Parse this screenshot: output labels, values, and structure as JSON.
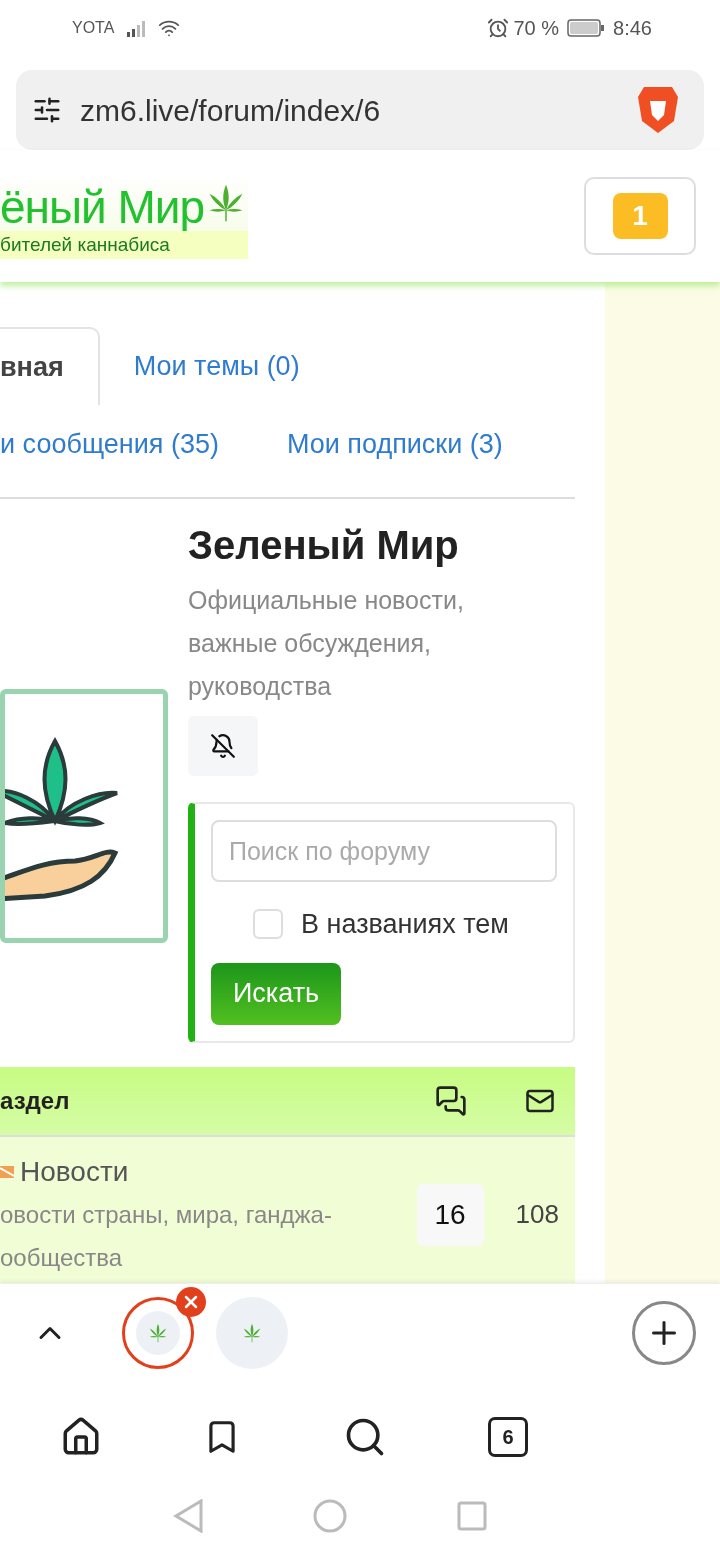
{
  "status_bar": {
    "carrier": "YOTA",
    "battery": "70 %",
    "time": "8:46"
  },
  "address_bar": {
    "url": "zm6.live/forum/index/6"
  },
  "header": {
    "logo_title": "ёный Мир",
    "logo_subtitle": "бителей каннабиса",
    "notification_count": "1"
  },
  "tabs": [
    {
      "label": "вная",
      "selected": true
    },
    {
      "label": "Мои темы (0)",
      "selected": false
    },
    {
      "label": "и сообщения (35)",
      "selected": false
    },
    {
      "label": "Мои подписки (3)",
      "selected": false
    }
  ],
  "forum": {
    "title": "Зеленый Мир",
    "description": "Официальные новости, важные обсуждения, руководства"
  },
  "search": {
    "placeholder": "Поиск по форуму",
    "titles_only": {
      "label": "В названиях тем",
      "checked": false
    },
    "button": "Искать"
  },
  "table": {
    "columns": [
      "аздел"
    ],
    "rows": [
      {
        "title": "Новости",
        "description_lines": [
          "овости страны, мира, ганджа-",
          "ообщества"
        ],
        "topics": "16",
        "posts": "108"
      }
    ]
  },
  "browser_tabs": [
    {
      "selected": true
    },
    {
      "selected": false
    }
  ],
  "tab_count": "6"
}
